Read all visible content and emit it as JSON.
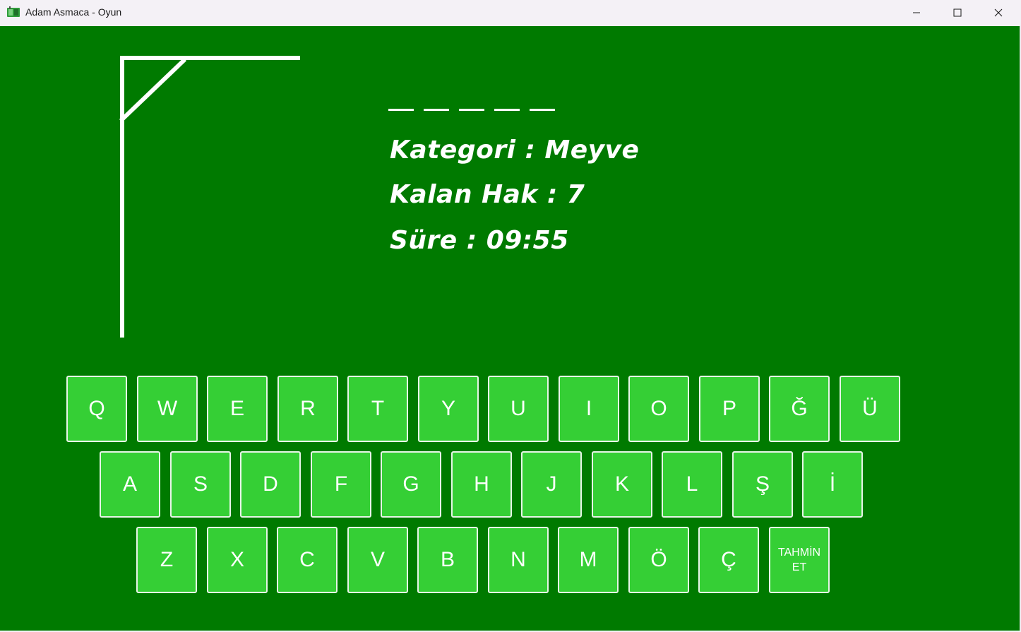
{
  "window": {
    "title": "Adam Asmaca - Oyun"
  },
  "game": {
    "word_slot_count": 5,
    "category_text": "Kategori :  Meyve",
    "lives_text": "Kalan Hak : 7",
    "time_text": "Süre : 09:55"
  },
  "keyboard": {
    "row1": [
      "Q",
      "W",
      "E",
      "R",
      "T",
      "Y",
      "U",
      "I",
      "O",
      "P",
      "Ğ",
      "Ü"
    ],
    "row2": [
      "A",
      "S",
      "D",
      "F",
      "G",
      "H",
      "J",
      "K",
      "L",
      "Ş",
      "İ"
    ],
    "row3": [
      "Z",
      "X",
      "C",
      "V",
      "B",
      "N",
      "M",
      "Ö",
      "Ç"
    ],
    "guess_label": "TAHMİN\nET"
  },
  "colors": {
    "background": "#007a00",
    "key": "#35cf35",
    "text": "#ffffff"
  }
}
